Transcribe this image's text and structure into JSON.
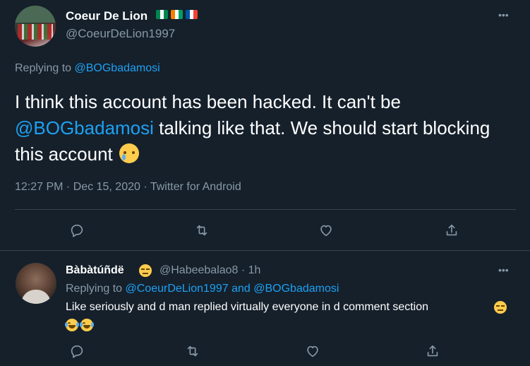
{
  "main_tweet": {
    "display_name": "Coeur De Lion",
    "flags": [
      {
        "name": "nigeria-flag",
        "colors": [
          "#008751",
          "#ffffff",
          "#008751"
        ]
      },
      {
        "name": "ivory-coast-flag",
        "colors": [
          "#f77f00",
          "#ffffff",
          "#009e60"
        ]
      },
      {
        "name": "france-flag",
        "colors": [
          "#0055a4",
          "#ffffff",
          "#ef4135"
        ]
      }
    ],
    "handle": "@CoeurDeLion1997",
    "more_icon": "•••",
    "replying_to_label": "Replying to",
    "replying_to_user": "@BOGbadamosi",
    "text_part1": "I think this account has been hacked. It can't be",
    "text_mention": "@BOGbadamosi",
    "text_part2": "talking like that. We should start blocking this account",
    "emoji": "crying-face",
    "timestamp": "12:27 PM · Dec 15, 2020 · Twitter for Android"
  },
  "reply_tweet": {
    "display_name": "Bàbàtúñdë",
    "name_emoji": "unamused-face",
    "handle_time": "@Habeebalao8 · 1h",
    "more_icon": "•••",
    "replying_to_label": "Replying to",
    "replying_to_user1": "@CoeurDeLion1997",
    "replying_and": "and",
    "replying_to_user2": "@BOGbadamosi",
    "text": "Like seriously and d man replied virtually everyone in d comment section",
    "text_emojis": [
      "unamused-face",
      "face-with-tears-of-joy",
      "face-with-tears-of-joy"
    ]
  },
  "actions": {
    "icons": [
      "reply-icon",
      "retweet-icon",
      "like-icon",
      "share-icon"
    ]
  },
  "colors": {
    "background": "#15202b",
    "accent": "#1da1f2",
    "secondary_text": "#8899a6",
    "border": "#38444d"
  }
}
